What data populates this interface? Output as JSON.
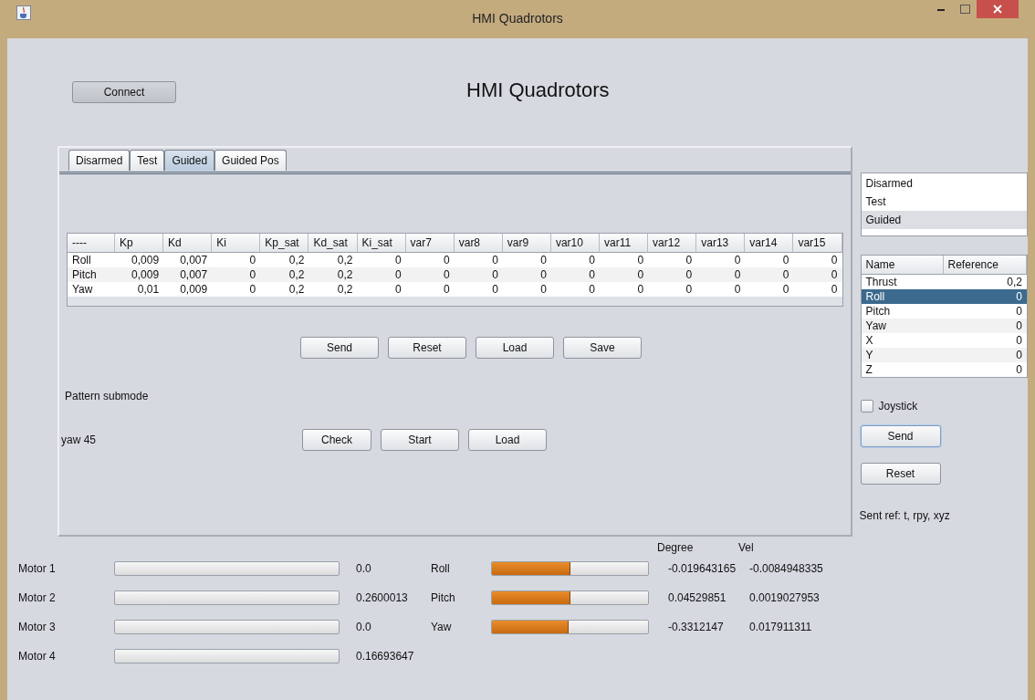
{
  "window": {
    "title": "HMI Quadrotors"
  },
  "connect_button": "Connect",
  "heading": "HMI Quadrotors",
  "tabs": [
    {
      "label": "Disarmed",
      "selected": false
    },
    {
      "label": "Test",
      "selected": false
    },
    {
      "label": "Guided",
      "selected": true
    },
    {
      "label": "Guided Pos",
      "selected": false
    }
  ],
  "gains_table": {
    "columns": [
      "----",
      "Kp",
      "Kd",
      "Ki",
      "Kp_sat",
      "Kd_sat",
      "Ki_sat",
      "var7",
      "var8",
      "var9",
      "var10",
      "var11",
      "var12",
      "var13",
      "var14",
      "var15"
    ],
    "rows": [
      [
        "Roll",
        "0,009",
        "0,007",
        "0",
        "0,2",
        "0,2",
        "0",
        "0",
        "0",
        "0",
        "0",
        "0",
        "0",
        "0",
        "0",
        "0"
      ],
      [
        "Pitch",
        "0,009",
        "0,007",
        "0",
        "0,2",
        "0,2",
        "0",
        "0",
        "0",
        "0",
        "0",
        "0",
        "0",
        "0",
        "0",
        "0"
      ],
      [
        "Yaw",
        "0,01",
        "0,009",
        "0",
        "0,2",
        "0,2",
        "0",
        "0",
        "0",
        "0",
        "0",
        "0",
        "0",
        "0",
        "0",
        "0"
      ]
    ]
  },
  "gains_buttons": [
    "Send",
    "Reset",
    "Load",
    "Save"
  ],
  "pattern_label": "Pattern submode",
  "pattern_value": "yaw 45",
  "pattern_buttons": [
    "Check",
    "Start",
    "Load"
  ],
  "mode_list": [
    {
      "label": "Disarmed",
      "selected": false
    },
    {
      "label": "Test",
      "selected": false
    },
    {
      "label": "Guided",
      "selected": true
    }
  ],
  "reference_table": {
    "columns": [
      "Name",
      "Reference"
    ],
    "rows": [
      {
        "name": "Thrust",
        "value": "0,2",
        "selected": false
      },
      {
        "name": "Roll",
        "value": "0",
        "selected": true
      },
      {
        "name": "Pitch",
        "value": "0",
        "selected": false
      },
      {
        "name": "Yaw",
        "value": "0",
        "selected": false
      },
      {
        "name": "X",
        "value": "0",
        "selected": false
      },
      {
        "name": "Y",
        "value": "0",
        "selected": false
      },
      {
        "name": "Z",
        "value": "0",
        "selected": false
      }
    ]
  },
  "joystick": {
    "label": "Joystick",
    "checked": false
  },
  "reference_buttons": [
    "Send",
    "Reset"
  ],
  "sent_ref": "Sent ref: t, rpy, xyz",
  "attitude_headers": [
    "Degree",
    "Vel"
  ],
  "motors": [
    {
      "name": "Motor 1",
      "level": 0,
      "reading": "0.0"
    },
    {
      "name": "Motor 2",
      "level": 0,
      "reading": "0.2600013"
    },
    {
      "name": "Motor 3",
      "level": 0,
      "reading": "0.0"
    },
    {
      "name": "Motor 4",
      "level": 0,
      "reading": "0.16693647"
    }
  ],
  "attitude": [
    {
      "name": "Roll",
      "level": 0.5,
      "degree": "-0.019643165",
      "vel": "-0.0084948335"
    },
    {
      "name": "Pitch",
      "level": 0.5,
      "degree": "0.04529851",
      "vel": "0.0019027953"
    },
    {
      "name": "Yaw",
      "level": 0.49,
      "degree": "-0.3312147",
      "vel": "0.017911311"
    }
  ]
}
